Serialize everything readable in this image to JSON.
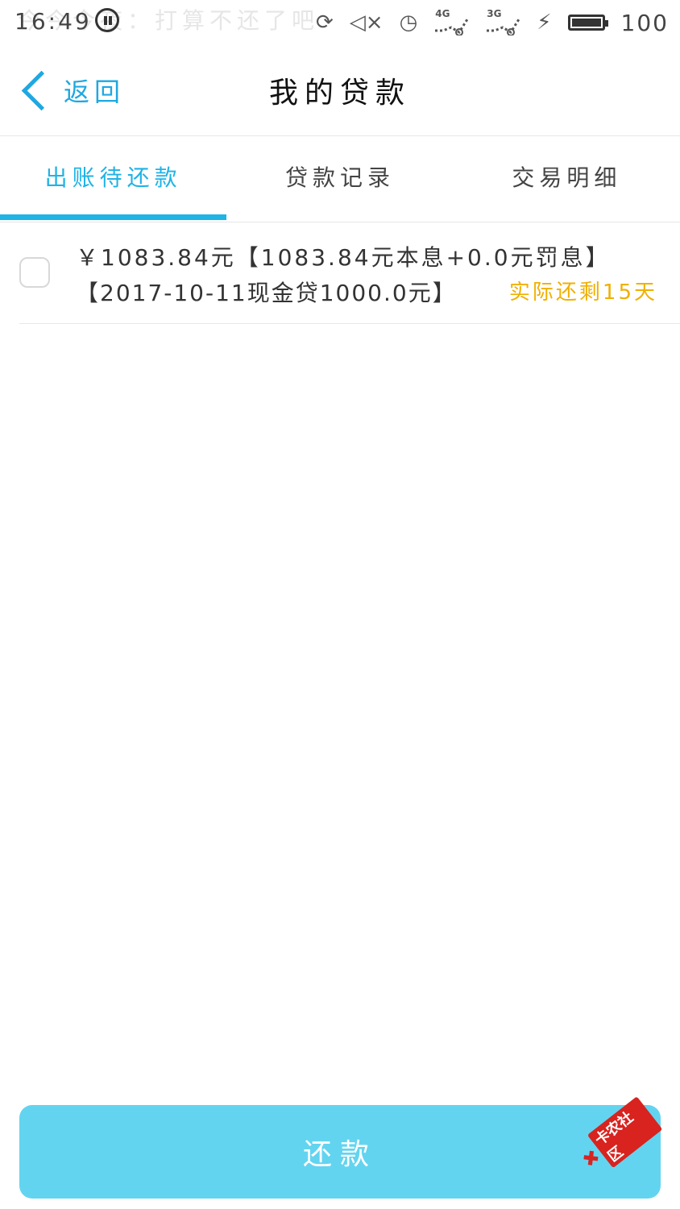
{
  "status_bar": {
    "time": "16:49",
    "notification_text": "今今今夜：打算不还了吧",
    "network_1": "4G",
    "network_2": "3G",
    "battery_level": "100"
  },
  "header": {
    "back_label": "返回",
    "title": "我的贷款"
  },
  "tabs": [
    {
      "label": "出账待还款",
      "active": true
    },
    {
      "label": "贷款记录",
      "active": false
    },
    {
      "label": "交易明细",
      "active": false
    }
  ],
  "loan_item": {
    "line1": "￥1083.84元【1083.84元本息+0.0元罚息】",
    "line2": "【2017-10-11现金贷1000.0元】",
    "remaining": "实际还剩15天"
  },
  "footer": {
    "repay_label": "还款"
  },
  "watermark": {
    "text": "卡农社区"
  },
  "colors": {
    "accent": "#1fb3e6",
    "button": "#63d4f0",
    "remaining": "#f0b000"
  }
}
